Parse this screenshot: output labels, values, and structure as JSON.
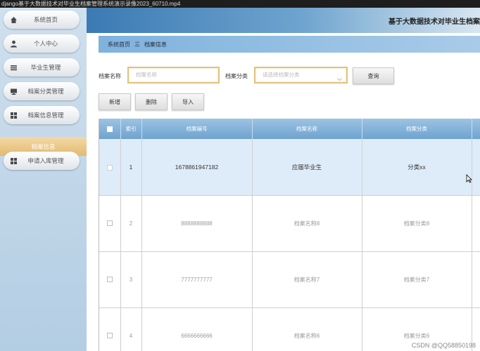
{
  "window": {
    "title": "django基于大数据技术对毕业生档案管理系统演示录像2023_60710.mp4"
  },
  "header": {
    "site_title": "基于大数据技术对毕业生档案"
  },
  "sidebar": {
    "items": [
      {
        "label": "系统首页",
        "icon": "home-icon"
      },
      {
        "label": "个人中心",
        "icon": "user-icon"
      },
      {
        "label": "毕业生管理",
        "icon": "list-icon"
      },
      {
        "label": "档案分类管理",
        "icon": "monitor-icon"
      },
      {
        "label": "档案信息管理",
        "icon": "grid-icon"
      },
      {
        "label": "档案信息",
        "active": true
      },
      {
        "label": "申请入库管理",
        "icon": "grid-icon"
      }
    ]
  },
  "breadcrumb": {
    "home": "系统首页",
    "separator": "三",
    "current": "档案信息"
  },
  "search": {
    "name_label": "档案名称",
    "name_placeholder": "档案名称",
    "category_label": "档案分类",
    "category_placeholder": "请选择档案分类",
    "query_button": "查询"
  },
  "actions": {
    "add": "新增",
    "delete": "删除",
    "import": "导入"
  },
  "table": {
    "columns": [
      "索引",
      "档案编号",
      "档案名称",
      "档案分类"
    ],
    "rows": [
      {
        "index": "1",
        "code": "1678861947182",
        "name": "应届毕业生",
        "category": "分类xx"
      },
      {
        "index": "2",
        "code": "8888888888",
        "name": "档案名称8",
        "category": "档案分类8"
      },
      {
        "index": "3",
        "code": "7777777777",
        "name": "档案名称7",
        "category": "档案分类7"
      },
      {
        "index": "4",
        "code": "6666666666",
        "name": "档案名称6",
        "category": "档案分类6"
      }
    ]
  },
  "watermark": "CSDN @QQ58850198",
  "colors": {
    "accent": "#6fa3cf",
    "active": "#e3ba6f",
    "input_border": "#e2c27a"
  }
}
